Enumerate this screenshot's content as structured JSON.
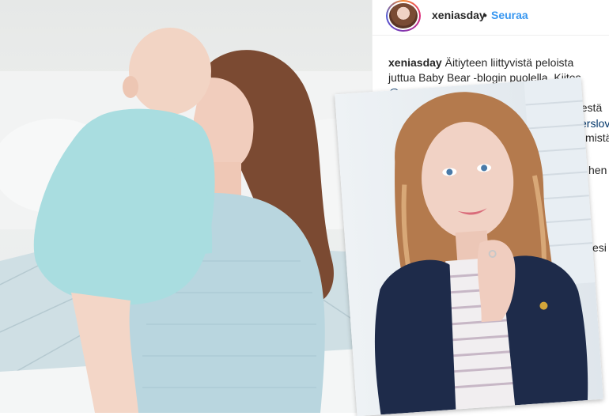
{
  "post": {
    "username": "xeniasday",
    "separator": "•",
    "follow_label": "Seuraa",
    "caption_username": "xeniasday",
    "caption_line1": " Äitiyteen liittyvistä peloista",
    "caption_line2": "juttua Baby Bear -blogin puolella. Kiitos",
    "caption_mention": "@guguukids",
    "caption_frag_risesta": "risestä",
    "caption_frag_erslove": "erslove",
    "caption_frag_mista": "mistä",
    "caption_frag_hen": "hen",
    "caption_frag_esi": "esi"
  },
  "icons": {
    "avatar": "profile-avatar"
  },
  "colors": {
    "follow_blue": "#3897f0",
    "mention_navy": "#003569",
    "sweater_blue": "#b9d6df",
    "onesie_blue": "#a9dde0",
    "blazer_navy": "#1e2b4a"
  }
}
